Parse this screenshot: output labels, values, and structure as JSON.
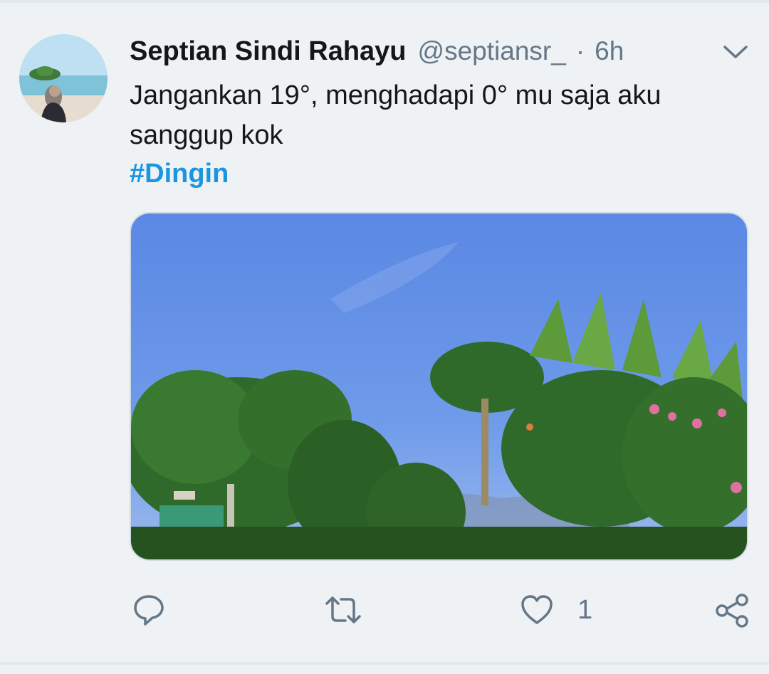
{
  "tweet": {
    "author_name": "Septian Sindi Rahayu",
    "handle": "@septiansr_",
    "separator": "·",
    "time": "6h",
    "text": "Jangankan 19°, menghadapi 0° mu saja aku sanggup kok",
    "hashtag": "#Dingin"
  },
  "actions": {
    "reply": {
      "icon": "reply-icon"
    },
    "retweet": {
      "icon": "retweet-icon"
    },
    "like": {
      "icon": "heart-icon",
      "count": "1"
    },
    "share": {
      "icon": "share-icon"
    }
  },
  "colors": {
    "background": "#eef2f5",
    "text": "#14171a",
    "secondary": "#657786",
    "link": "#1b95e0"
  }
}
